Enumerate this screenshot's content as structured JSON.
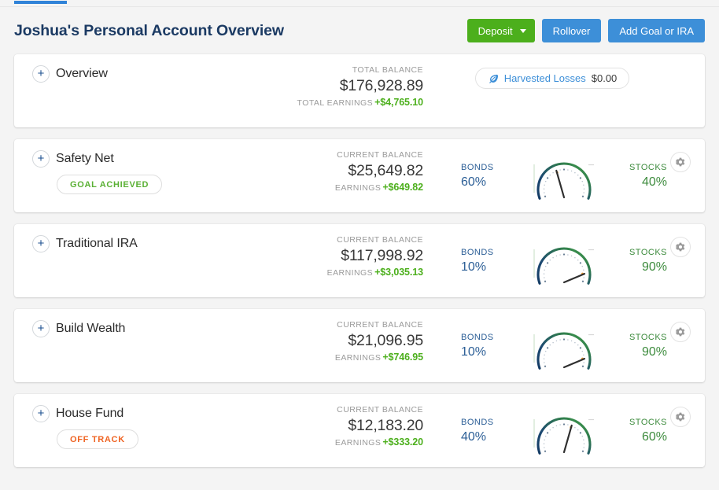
{
  "header": {
    "title": "Joshua's Personal Account Overview",
    "buttons": {
      "deposit": "Deposit",
      "rollover": "Rollover",
      "add_goal": "Add Goal or IRA"
    }
  },
  "labels": {
    "plus": "+",
    "total_balance": "TOTAL BALANCE",
    "total_earnings": "TOTAL EARNINGS",
    "current_balance": "CURRENT BALANCE",
    "earnings": "EARNINGS",
    "bonds": "BONDS",
    "stocks": "STOCKS"
  },
  "overview": {
    "name": "Overview",
    "balance": "$176,928.89",
    "earnings": "+$4,765.10",
    "harvested_losses_label": "Harvested Losses",
    "harvested_losses_value": "$0.00"
  },
  "goals": [
    {
      "name": "Safety Net",
      "badge": "GOAL ACHIEVED",
      "badge_type": "green",
      "balance": "$25,649.82",
      "earnings": "+$649.82",
      "bonds_pct": "60%",
      "stocks_pct": "40%",
      "stocks_value": 40
    },
    {
      "name": "Traditional IRA",
      "badge": null,
      "badge_type": null,
      "balance": "$117,998.92",
      "earnings": "+$3,035.13",
      "bonds_pct": "10%",
      "stocks_pct": "90%",
      "stocks_value": 90
    },
    {
      "name": "Build Wealth",
      "badge": null,
      "badge_type": null,
      "balance": "$21,096.95",
      "earnings": "+$746.95",
      "bonds_pct": "10%",
      "stocks_pct": "90%",
      "stocks_value": 90
    },
    {
      "name": "House Fund",
      "badge": "OFF TRACK",
      "badge_type": "orange",
      "balance": "$12,183.20",
      "earnings": "+$333.20",
      "bonds_pct": "40%",
      "stocks_pct": "60%",
      "stocks_value": 60
    }
  ],
  "colors": {
    "accent_blue": "#3d8fd8",
    "deposit_green": "#4caf1c",
    "title_navy": "#1b3a63",
    "earnings_green": "#4caf1c",
    "off_track_orange": "#ef6322",
    "gauge_start": "#1b3a63",
    "gauge_end": "#3d9140"
  }
}
